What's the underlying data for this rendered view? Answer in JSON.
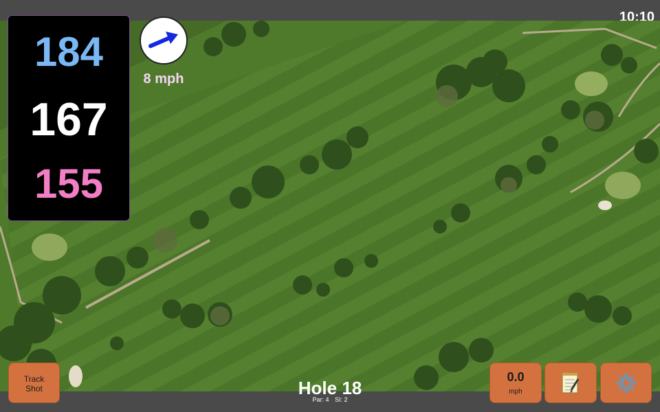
{
  "status": {
    "time": "10:10"
  },
  "distances": {
    "back": "184",
    "middle": "167",
    "front": "155"
  },
  "wind": {
    "speed": "8 mph",
    "icon": "wind-direction-arrow-icon"
  },
  "buttons": {
    "track_shot_line1": "Track",
    "track_shot_line2": "Shot",
    "speed_value": "0.0",
    "speed_unit": "mph",
    "notes_icon": "notepad-icon",
    "settings_icon": "gear-icon"
  },
  "hole": {
    "title": "Hole 18",
    "par": "Par: 4",
    "si": "SI: 2"
  },
  "colors": {
    "back_distance": "#7ab8f5",
    "middle_distance": "#ffffff",
    "front_distance": "#f27ec6",
    "button": "#d4723f",
    "wind_arrow": "#1428e0"
  }
}
